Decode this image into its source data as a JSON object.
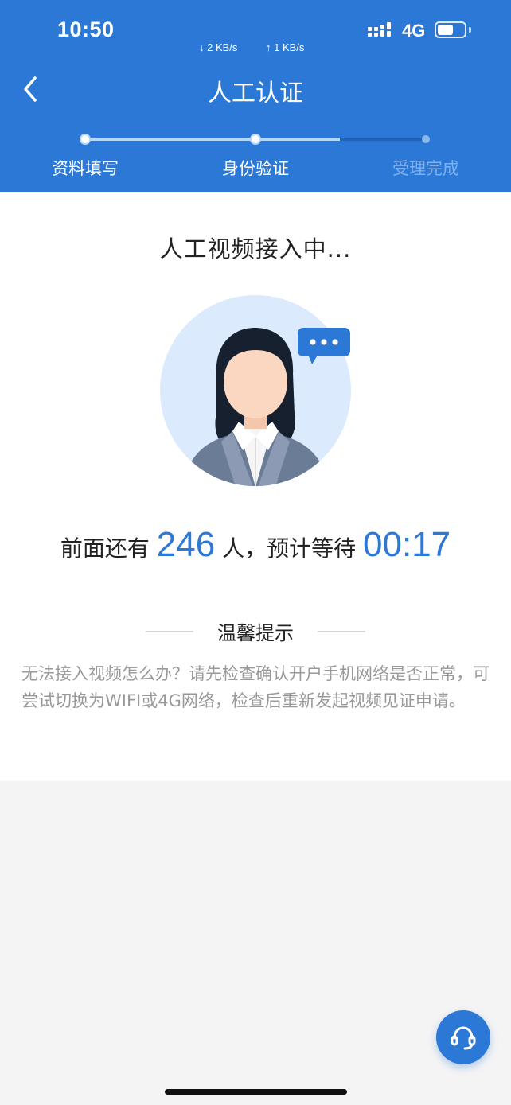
{
  "status_bar": {
    "time": "10:50",
    "download_speed": "↓ 2 KB/s",
    "upload_speed": "↑ 1 KB/s",
    "carrier": "4G",
    "battery_level": 0.6
  },
  "header": {
    "title": "人工认证",
    "steps": [
      {
        "label": "资料填写",
        "state": "done"
      },
      {
        "label": "身份验证",
        "state": "current"
      },
      {
        "label": "受理完成",
        "state": "pending"
      }
    ]
  },
  "main": {
    "status_text": "人工视频接入中...",
    "queue": {
      "prefix": "前面还有",
      "count": "246",
      "middle": "人，预计等待",
      "wait_time": "00:17"
    },
    "tip": {
      "title": "温馨提示",
      "text": "无法接入视频怎么办？请先检查确认开户手机网络是否正常，可尝试切换为WIFI或4G网络，检查后重新发起视频见证申请。"
    }
  },
  "colors": {
    "primary": "#2b78d6",
    "accent_number": "#2b78d6",
    "background": "#f4f4f5"
  }
}
